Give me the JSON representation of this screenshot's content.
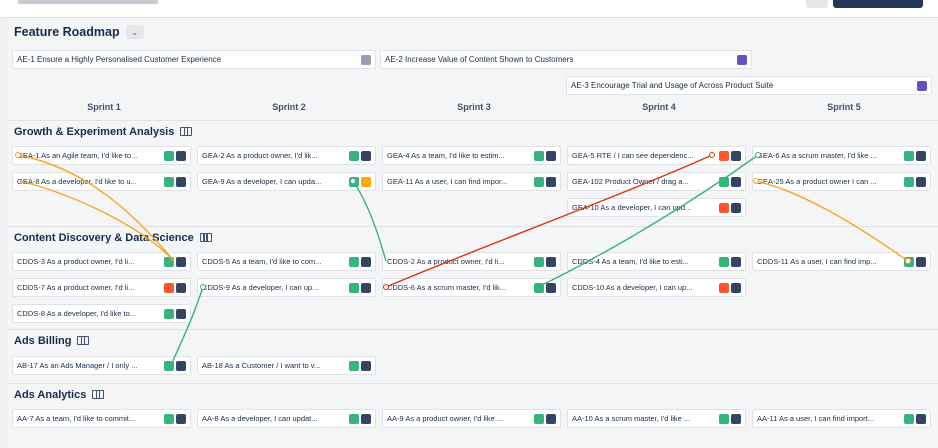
{
  "roadmap": {
    "title": "Feature Roadmap",
    "caret": "⌄"
  },
  "features": [
    {
      "label": "AE-1 Ensure a Highly Personalised Customer Experience",
      "icon": "square-icon",
      "icon_color": "#97a0af"
    },
    {
      "label": "AE-2 Increase Value of Content Shown to Customers",
      "icon": "square-icon",
      "icon_color": "#6554c0"
    },
    {
      "label": "AE-3 Encourage Trial and Usage of Across Product Suite",
      "icon": "square-icon",
      "icon_color": "#6554c0"
    }
  ],
  "sprints": [
    "Sprint 1",
    "Sprint 2",
    "Sprint 3",
    "Sprint 4",
    "Sprint 5"
  ],
  "groups": [
    {
      "title": "Growth & Experiment Analysis",
      "rows": [
        [
          "GEA-1 As an Agile team, I'd like to...",
          "GEA-2 As a product owner, I'd lik...",
          "GEA-4 As a team, I'd like to estim...",
          "GEA-5 RTE / I can see dependenc...",
          "GEA-6 As a scrum master, I'd like ..."
        ],
        [
          "GEA-8 As a developer, I'd like to u...",
          "GEA-9 As a developer, I can upda...",
          "GEA-11 As a user, I can find impor...",
          "GEA-102 Product Owner / drag a...",
          "GEA-25 As a product owner I can ..."
        ],
        [
          "",
          "",
          "",
          "GEA-10 As a developer, I can upd...",
          ""
        ]
      ]
    },
    {
      "title": "Content Discovery & Data Science",
      "rows": [
        [
          "CDDS-3 As a product owner, I'd li...",
          "CDDS-5 As a team, I'd like to com...",
          "CDDS-2 As a product owner, I'd li...",
          "CDDS-4 As a team, I'd like to esti...",
          "CDDS-11 As a user, I can find imp..."
        ],
        [
          "CDDS-7 As a product owner, I'd li...",
          "CDDS-9 As a developer, I can up...",
          "CDDS-6 As a scrum master, I'd lik...",
          "CDDS-10 As a developer, I can up...",
          ""
        ],
        [
          "CDDS-8 As a developer, I'd like to...",
          "",
          "",
          "",
          ""
        ]
      ]
    },
    {
      "title": "Ads Billing",
      "rows": [
        [
          "AB-17 As an Ads Manager / I only ...",
          "AB-18 As a Customer / I want to v...",
          "",
          "",
          ""
        ]
      ]
    },
    {
      "title": "Ads Analytics",
      "rows": [
        [
          "AA-7 As a team, I'd like to commit...",
          "AA-8 As a developer, I can updat...",
          "AA-9 As a product owner, I'd like ...",
          "AA-10 As a scrum master, I'd like ...",
          "AA-11 As a user, I can find import..."
        ]
      ]
    }
  ],
  "colors": {
    "story_badge": "#36b37e",
    "blocked_badge": "#ff5630",
    "dependency_green": "#36b37e",
    "dependency_orange": "#f5a623",
    "dependency_red": "#de350b",
    "avatar": "#344563"
  }
}
